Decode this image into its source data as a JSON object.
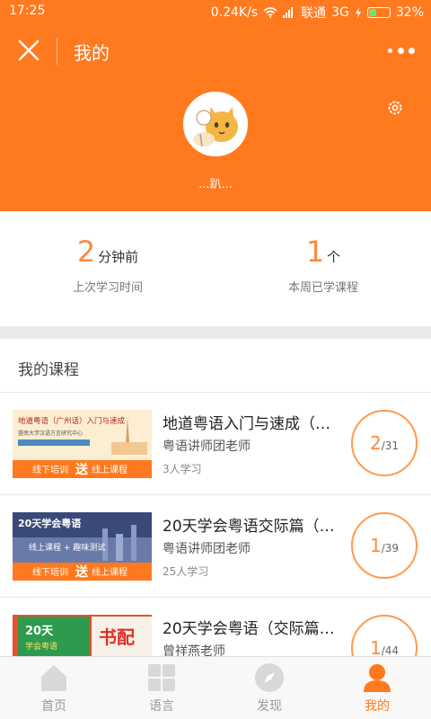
{
  "status_bar": {
    "time": "17:25",
    "network_speed": "0.24K/s",
    "carrier": "联通",
    "network_type": "3G",
    "battery": "32%"
  },
  "header": {
    "title": "我的",
    "username": "...趴...",
    "icons": [
      "close-icon",
      "more-icon",
      "settings-icon",
      "avatar"
    ],
    "background_color": "#ff7a1f"
  },
  "stats": {
    "last_study": {
      "value": "2",
      "unit": "分钟前",
      "label": "上次学习时间"
    },
    "weekly_courses": {
      "value": "1",
      "unit": "个",
      "label": "本周已学课程"
    }
  },
  "courses_section": {
    "title": "我的课程",
    "items": [
      {
        "title": "地道粤语入门与速成（…",
        "teacher": "粤语讲师团老师",
        "learners": "3人学习",
        "progress_done": "2",
        "progress_total": "/31",
        "thumb": {
          "line1": "地道粤语（广州话）入门与速成",
          "line2": "暨南大学汉语方言研究中心",
          "banner": "线下培训",
          "banner_highlight": "送",
          "banner_end": "线上课程"
        }
      },
      {
        "title": "20天学会粤语交际篇（…",
        "teacher": "粤语讲师团老师",
        "learners": "25人学习",
        "progress_done": "1",
        "progress_total": "/39",
        "thumb": {
          "line1": "20天学会粤语",
          "line2": "线上课程 + 趣味测试",
          "banner": "线下培训",
          "banner_highlight": "送",
          "banner_end": "线上课程"
        }
      },
      {
        "title": "20天学会粤语（交际篇…",
        "teacher": "曾祥燕老师",
        "learners": "",
        "progress_done": "1",
        "progress_total": "/44",
        "thumb": {
          "line1": "20天",
          "line2": "学会粤语",
          "stamp": "书配"
        }
      }
    ]
  },
  "tab_bar": {
    "tabs": [
      {
        "label": "首页",
        "icon": "home-icon",
        "active": false
      },
      {
        "label": "语言",
        "icon": "grid-icon",
        "active": false
      },
      {
        "label": "发现",
        "icon": "compass-icon",
        "active": false
      },
      {
        "label": "我的",
        "icon": "user-icon",
        "active": true
      }
    ],
    "active_color": "#ff7a1f"
  }
}
